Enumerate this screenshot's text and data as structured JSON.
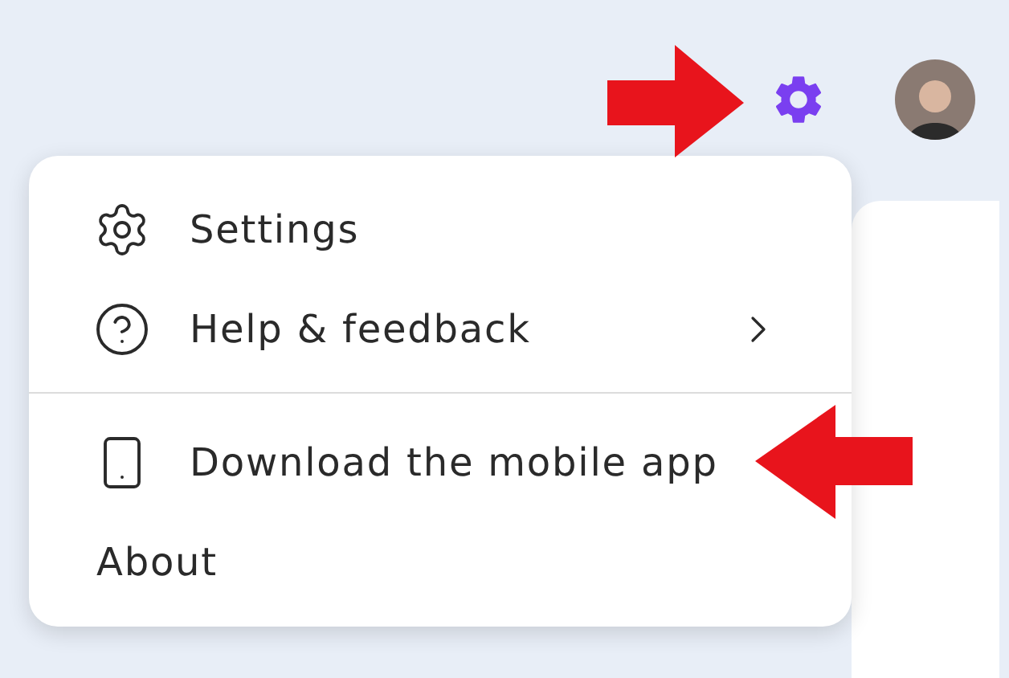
{
  "menu": {
    "items": [
      {
        "kind": "settings",
        "label": "Settings",
        "submenu": false
      },
      {
        "kind": "help",
        "label": "Help & feedback",
        "submenu": true
      },
      {
        "kind": "divider"
      },
      {
        "kind": "mobile",
        "label": "Download the mobile app",
        "submenu": false
      },
      {
        "kind": "plain",
        "label": "About",
        "submenu": false
      }
    ]
  }
}
